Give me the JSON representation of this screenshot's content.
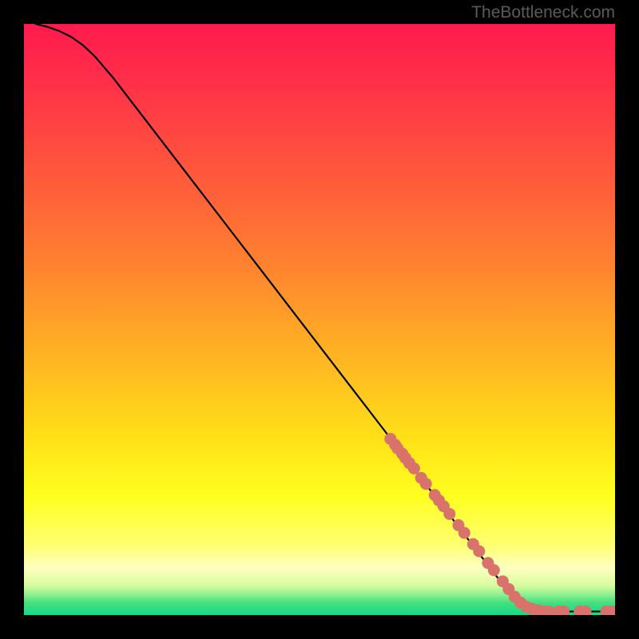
{
  "attribution": "TheBottleneck.com",
  "chart_data": {
    "type": "line",
    "title": "",
    "xlabel": "",
    "ylabel": "",
    "xlim": [
      0,
      100
    ],
    "ylim": [
      0,
      100
    ],
    "grid": false,
    "series": [
      {
        "name": "curve",
        "style": "line",
        "color": "#000000",
        "x": [
          2,
          4,
          6,
          8,
          10,
          12,
          15,
          20,
          25,
          30,
          35,
          40,
          45,
          50,
          55,
          60,
          65,
          70,
          75,
          80,
          82,
          84,
          85,
          87,
          90,
          93,
          95,
          97,
          100
        ],
        "y": [
          100,
          99.5,
          98.8,
          97.8,
          96.4,
          94.5,
          91,
          84.5,
          78,
          71.5,
          65,
          58.5,
          52,
          45.5,
          39,
          32.5,
          26,
          19.5,
          13,
          6.5,
          4,
          1.8,
          1,
          0.6,
          0.6,
          0.6,
          0.6,
          0.6,
          0.6
        ]
      },
      {
        "name": "highlighted-points",
        "style": "scatter",
        "color": "#d8726a",
        "x": [
          62,
          62.8,
          63.2,
          64,
          64.5,
          65.2,
          66,
          67.2,
          68,
          69.5,
          70.2,
          71,
          72,
          73.5,
          74.5,
          76,
          77,
          78.5,
          79.5,
          81,
          82,
          83,
          84,
          85,
          86,
          87,
          88,
          88.8,
          90.5,
          91.3,
          94,
          95,
          98.5,
          99.5
        ],
        "y": [
          29.8,
          28.8,
          28.2,
          27.3,
          26.6,
          25.7,
          24.8,
          23.2,
          22.2,
          20.3,
          19.4,
          18.4,
          17.1,
          15.2,
          13.9,
          12,
          10.8,
          8.8,
          7.6,
          5.7,
          4.4,
          3.1,
          2.1,
          1.4,
          1,
          0.8,
          0.6,
          0.6,
          0.6,
          0.6,
          0.6,
          0.6,
          0.6,
          0.6
        ]
      }
    ],
    "background_gradient": {
      "type": "vertical",
      "stops": [
        {
          "pos": 0.0,
          "color": "#ff1a4e"
        },
        {
          "pos": 0.1,
          "color": "#ff3048"
        },
        {
          "pos": 0.2,
          "color": "#ff4a40"
        },
        {
          "pos": 0.3,
          "color": "#ff6438"
        },
        {
          "pos": 0.4,
          "color": "#ff8030"
        },
        {
          "pos": 0.5,
          "color": "#ffa028"
        },
        {
          "pos": 0.6,
          "color": "#ffc020"
        },
        {
          "pos": 0.7,
          "color": "#ffe018"
        },
        {
          "pos": 0.8,
          "color": "#ffff20"
        },
        {
          "pos": 0.88,
          "color": "#ffff70"
        },
        {
          "pos": 0.92,
          "color": "#ffffc0"
        },
        {
          "pos": 0.95,
          "color": "#d8fca0"
        },
        {
          "pos": 0.965,
          "color": "#90f090"
        },
        {
          "pos": 0.98,
          "color": "#40e080"
        },
        {
          "pos": 1.0,
          "color": "#18d888"
        }
      ]
    }
  }
}
